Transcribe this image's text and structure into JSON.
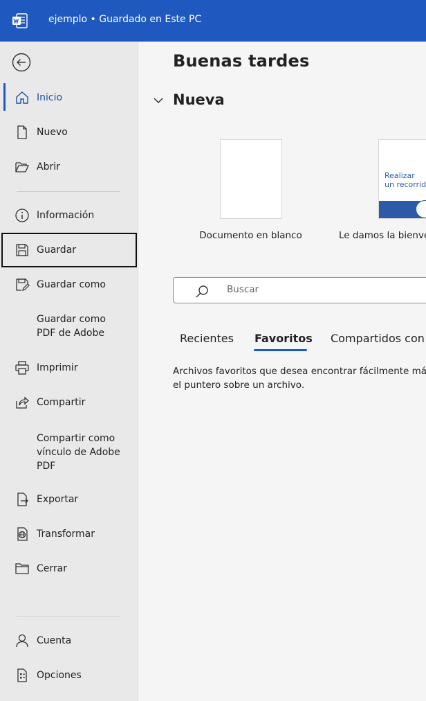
{
  "titlebar": {
    "title": "ejemplo • Guardado en Este PC",
    "accent": "#1f59bf",
    "app_icon": "word-icon"
  },
  "sidebar": {
    "back_icon": "back-arrow-icon",
    "items": [
      {
        "id": "inicio",
        "label": "Inicio",
        "icon": "home-icon",
        "active": true
      },
      {
        "id": "nuevo",
        "label": "Nuevo",
        "icon": "new-document-icon"
      },
      {
        "id": "abrir",
        "label": "Abrir",
        "icon": "folder-open-icon"
      },
      {
        "id": "informacion",
        "label": "Información",
        "icon": "info-icon"
      },
      {
        "id": "guardar",
        "label": "Guardar",
        "icon": "save-icon",
        "focused": true
      },
      {
        "id": "guardar-como",
        "label": "Guardar como",
        "icon": "save-as-icon"
      },
      {
        "id": "guardar-pdf",
        "label_line1": "Guardar como",
        "label_line2": "PDF de Adobe"
      },
      {
        "id": "imprimir",
        "label": "Imprimir",
        "icon": "printer-icon"
      },
      {
        "id": "compartir",
        "label": "Compartir",
        "icon": "share-icon"
      },
      {
        "id": "compartir-pdf",
        "label_line1": "Compartir como",
        "label_line2": "vínculo de Adobe",
        "label_line3": "PDF"
      },
      {
        "id": "exportar",
        "label": "Exportar",
        "icon": "export-icon"
      },
      {
        "id": "transformar",
        "label": "Transformar",
        "icon": "transform-icon"
      },
      {
        "id": "cerrar",
        "label": "Cerrar",
        "icon": "folder-close-icon"
      },
      {
        "id": "cuenta",
        "label": "Cuenta",
        "icon": "person-icon"
      },
      {
        "id": "opciones",
        "label": "Opciones",
        "icon": "options-icon"
      }
    ]
  },
  "main": {
    "greeting": "Buenas tardes",
    "nueva": {
      "title": "Nueva",
      "templates": [
        {
          "label": "Documento en blanco"
        },
        {
          "label": "Le damos la bienve",
          "thumb_line1": "Realizar",
          "thumb_line2": "un recorrido"
        }
      ]
    },
    "search": {
      "placeholder": "Buscar"
    },
    "tabs": [
      {
        "label": "Recientes"
      },
      {
        "label": "Favoritos",
        "active": true
      },
      {
        "label": "Compartidos con"
      }
    ],
    "favorites_text_line1": "Archivos favoritos que desea encontrar fácilmente más",
    "favorites_text_line2": "el puntero sobre un archivo."
  }
}
